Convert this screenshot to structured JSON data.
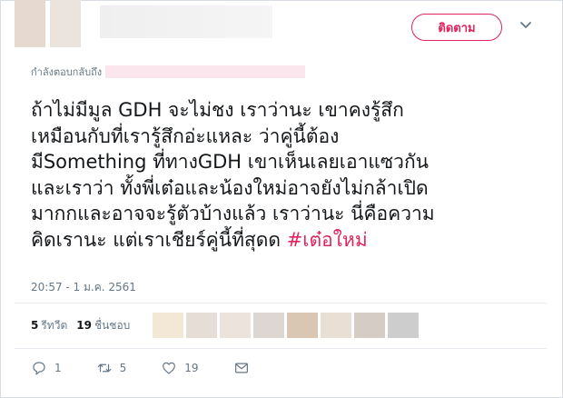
{
  "header": {
    "follow_label": "ติดตาม",
    "avatar_colors": [
      "#e6d9cf",
      "#eae3de"
    ]
  },
  "tweet": {
    "reply_prefix": "กำลังตอบกลับถึง",
    "text": "ถ้าไม่มีมูล GDH จะไม่ชง เราว่านะ เขาคงรู้สึก\nเหมือนกับที่เรารู้สึกอ่ะแหละ ว่าคู่นี้ต้อง\nมีSomething ที่ทางGDH เขาเห็นเลยเอาแซวกัน\nและเราว่า ทั้งพี่เต๋อและน้องใหม่อาจยังไม่กล้าเปิด\nมากกและอาจจะรู้ตัวบ้างแล้ว เราว่านะ นี่คือความ\nคิดเรานะ แต่เราเชียร์คู่นี้ที่สุดด ",
    "hashtag": "#เต๋อใหม่",
    "timestamp": "20:57 - 1 ม.ค. 2561"
  },
  "stats": {
    "retweets_count": "5",
    "retweets_label": "รีทวีต",
    "likes_count": "19",
    "likes_label": "ชื่นชอบ",
    "liker_avatar_colors": [
      "#f3e7d6",
      "#e6ddd6",
      "#ece3dc",
      "#ddd6d2",
      "#d9c7b4",
      "#e9dfd5",
      "#d5ccc6",
      "#cdcdcd"
    ]
  },
  "actions": {
    "reply_count": "1",
    "retweet_count": "5",
    "like_count": "19"
  },
  "colors": {
    "accent": "#e0245e",
    "secondary_text": "#657786",
    "primary_text": "#14171a"
  },
  "icons": {
    "reply": "speech-bubble-icon",
    "retweet": "retweet-icon",
    "like": "heart-icon",
    "dm": "envelope-icon",
    "more": "chevron-down-icon"
  }
}
